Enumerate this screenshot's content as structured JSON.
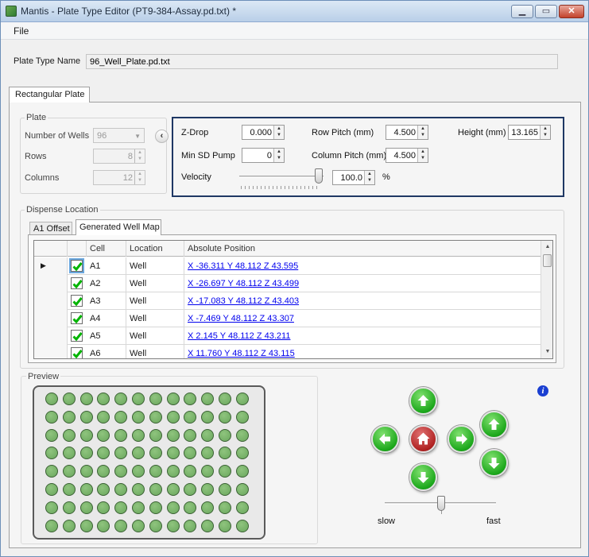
{
  "window": {
    "title": "Mantis - Plate Type Editor (PT9-384-Assay.pd.txt) *",
    "minimize_icon": "minimize-icon",
    "maximize_icon": "maximize-icon",
    "close_icon": "close-icon"
  },
  "menu": {
    "file": "File"
  },
  "plate_type_name": {
    "label": "Plate Type Name",
    "value": "96_Well_Plate.pd.txt"
  },
  "tabs": {
    "rectangular_plate": "Rectangular Plate"
  },
  "plate_group": {
    "title": "Plate",
    "number_of_wells_label": "Number of Wells",
    "number_of_wells_value": "96",
    "rows_label": "Rows",
    "rows_value": "8",
    "columns_label": "Columns",
    "columns_value": "12",
    "collapse_icon": "chevron-left-icon"
  },
  "parameters": {
    "z_drop_label": "Z-Drop",
    "z_drop_value": "0.000",
    "min_sd_pump_label": "Min SD Pump",
    "min_sd_pump_value": "0",
    "velocity_label": "Velocity",
    "velocity_value": "100.0",
    "velocity_unit": "%",
    "velocity_slider_percent": 100,
    "row_pitch_label": "Row Pitch (mm)",
    "row_pitch_value": "4.500",
    "column_pitch_label": "Column Pitch (mm)",
    "column_pitch_value": "4.500",
    "height_label": "Height (mm)",
    "height_value": "13.165"
  },
  "dispense_location": {
    "title": "Dispense Location",
    "tab_a1_offset": "A1 Offset",
    "tab_generated_well_map": "Generated Well Map",
    "columns": [
      "Cell",
      "Location",
      "Absolute Position"
    ],
    "rows": [
      {
        "cell": "A1",
        "location": "Well",
        "position": "X -36.311 Y 48.112 Z 43.595",
        "checked": true,
        "current": true
      },
      {
        "cell": "A2",
        "location": "Well",
        "position": "X -26.697 Y 48.112 Z 43.499",
        "checked": true,
        "current": false
      },
      {
        "cell": "A3",
        "location": "Well",
        "position": "X -17.083 Y 48.112 Z 43.403",
        "checked": true,
        "current": false
      },
      {
        "cell": "A4",
        "location": "Well",
        "position": "X -7.469 Y 48.112 Z 43.307",
        "checked": true,
        "current": false
      },
      {
        "cell": "A5",
        "location": "Well",
        "position": "X 2.145 Y 48.112 Z 43.211",
        "checked": true,
        "current": false
      },
      {
        "cell": "A6",
        "location": "Well",
        "position": "X 11.760 Y 48.112 Z 43.115",
        "checked": true,
        "current": false
      }
    ]
  },
  "preview": {
    "title": "Preview",
    "plate_rows": 8,
    "plate_columns": 12,
    "well_color": "#6aa75d"
  },
  "navigation": {
    "up_icon": "arrow-up-icon",
    "down_icon": "arrow-down-icon",
    "left_icon": "arrow-left-icon",
    "right_icon": "arrow-right-icon",
    "home_icon": "home-icon",
    "z_up_icon": "arrow-up-icon",
    "z_down_icon": "arrow-down-icon",
    "speed_slow_label": "slow",
    "speed_fast_label": "fast",
    "info_icon": "info-icon"
  },
  "colors": {
    "accent_box": "#1f3864",
    "nav_green": "#1da81c",
    "home_red": "#b02323",
    "link_blue": "#0000ee",
    "check_green": "#00b400"
  }
}
